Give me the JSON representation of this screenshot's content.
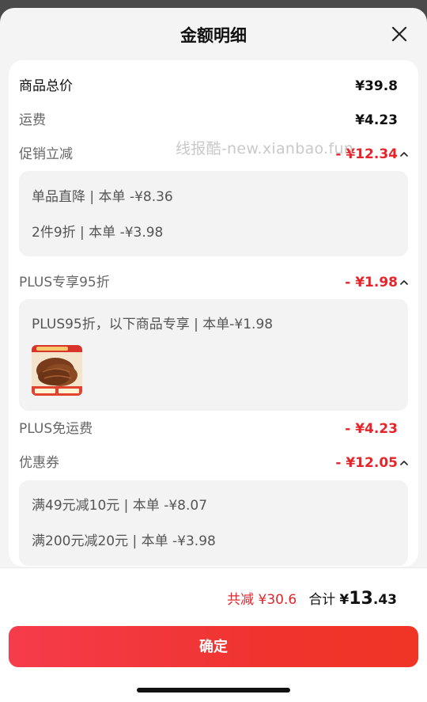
{
  "header": {
    "title": "金额明细",
    "close_icon": "close-icon"
  },
  "watermark": "线报酷-new.xianbao.fun",
  "rows": {
    "goods_total": {
      "label": "商品总价",
      "value": "¥39.8"
    },
    "shipping": {
      "label": "运费",
      "value": "¥4.23"
    },
    "promo": {
      "label": "促销立减",
      "value": "- ¥12.34",
      "details": [
        "单品直降 | 本单 -¥8.36",
        "2件9折 | 本单 -¥3.98"
      ]
    },
    "plus_discount": {
      "label": "PLUS专享95折",
      "value": "- ¥1.98",
      "details": [
        "PLUS95折，以下商品专享 | 本单-¥1.98"
      ]
    },
    "plus_free_shipping": {
      "label": "PLUS免运费",
      "value": "- ¥4.23"
    },
    "coupon": {
      "label": "优惠券",
      "value": "- ¥12.05",
      "details": [
        "满49元减10元 | 本单 -¥8.07",
        "满200元减20元 | 本单 -¥3.98"
      ]
    }
  },
  "summary": {
    "saved": "共减 ¥30.6",
    "total_label": "合计",
    "total_yen": "¥",
    "total_int": "13",
    "total_dec": ".43"
  },
  "confirm_label": "确定",
  "colors": {
    "accent_red": "#e4252b",
    "button_red": "#f03425"
  }
}
